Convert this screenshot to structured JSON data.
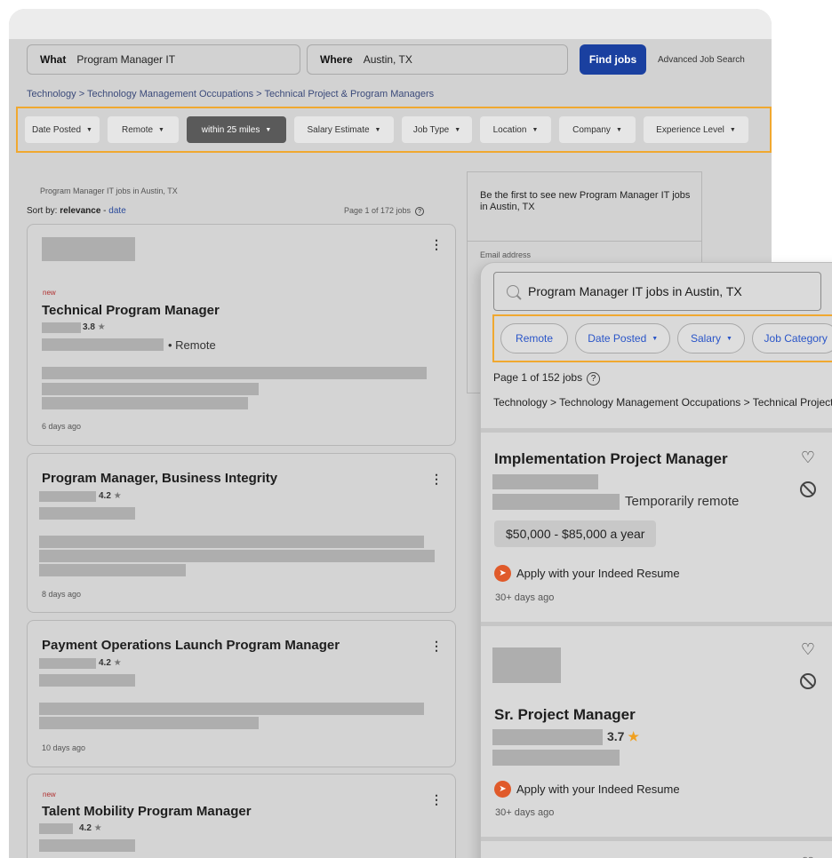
{
  "desktop": {
    "search": {
      "what_label": "What",
      "what_value": "Program Manager IT",
      "where_label": "Where",
      "where_value": "Austin, TX",
      "find_button": "Find jobs",
      "advanced_link": "Advanced Job Search"
    },
    "breadcrumb": "Technology > Technology Management Occupations > Technical Project & Program Managers",
    "filters": [
      {
        "label": "Date Posted",
        "active": false
      },
      {
        "label": "Remote",
        "active": false
      },
      {
        "label": "within 25 miles",
        "active": true
      },
      {
        "label": "Salary Estimate",
        "active": false
      },
      {
        "label": "Job Type",
        "active": false
      },
      {
        "label": "Location",
        "active": false
      },
      {
        "label": "Company",
        "active": false
      },
      {
        "label": "Experience Level",
        "active": false
      }
    ],
    "results_heading": "Program Manager IT jobs in Austin, TX",
    "sort": {
      "prefix": "Sort by:",
      "relevance": "relevance",
      "separator": " - ",
      "date": "date"
    },
    "page_count": "Page 1 of 172 jobs",
    "help_glyph": "?",
    "jobs": [
      {
        "new": "new",
        "title": "Technical Program Manager",
        "rating": "3.8",
        "location": "• Remote",
        "age": "6 days ago"
      },
      {
        "title": "Program Manager, Business Integrity",
        "rating": "4.2",
        "age": "8 days ago"
      },
      {
        "title": "Payment Operations Launch Program Manager",
        "rating": "4.2",
        "age": "10 days ago"
      },
      {
        "new": "new",
        "title": "Talent Mobility Program Manager",
        "rating": "4.2"
      }
    ],
    "alert": {
      "text": "Be the first to see new Program Manager IT jobs in Austin, TX",
      "email_label": "Email address"
    }
  },
  "mobile": {
    "search_value": "Program Manager IT jobs in Austin, TX",
    "filters": [
      {
        "label": "Remote",
        "dropdown": false
      },
      {
        "label": "Date Posted",
        "dropdown": true
      },
      {
        "label": "Salary",
        "dropdown": true
      },
      {
        "label": "Job Category",
        "dropdown": false
      }
    ],
    "page_count": "Page 1 of 152 jobs",
    "help_glyph": "?",
    "breadcrumb": "Technology > Technology Management Occupations > Technical Project & Program Managers",
    "jobs": [
      {
        "title": "Implementation Project Manager",
        "location": "Temporarily remote",
        "salary": "$50,000 - $85,000 a year",
        "apply": "Apply with your Indeed Resume",
        "age": "30+ days ago"
      },
      {
        "title": "Sr. Project Manager",
        "rating": "3.7",
        "apply": "Apply with your Indeed Resume",
        "age": "30+ days ago"
      }
    ]
  },
  "icons": {
    "star": "★",
    "heart": "♡",
    "kebab": "⋮",
    "caret": "▼",
    "apply": "➤"
  },
  "colors": {
    "find_button": "#1a40a0",
    "highlight_border": "#f0a830",
    "mobile_link": "#2a55c8",
    "apply_icon": "#e05a2a",
    "star_mobile": "#f0a020"
  }
}
